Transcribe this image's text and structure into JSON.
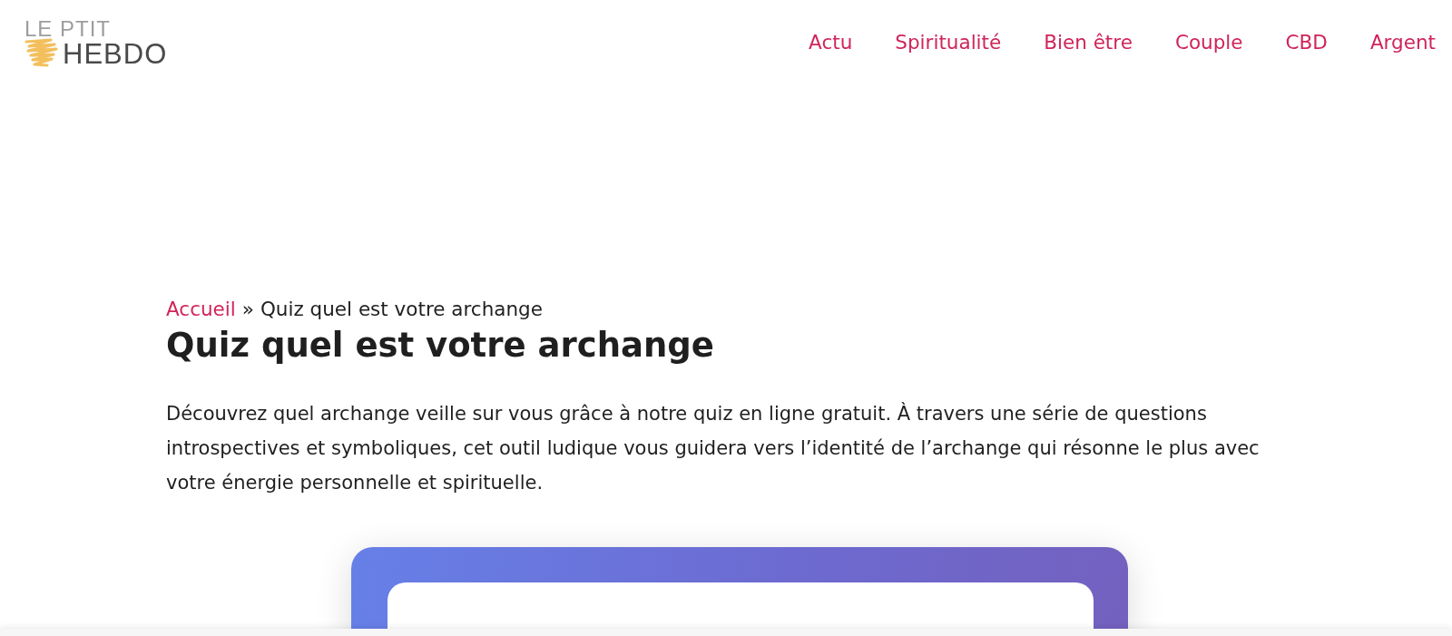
{
  "header": {
    "logo": {
      "line_1": "LE PTIT",
      "line_2": "HEBDO"
    },
    "nav": [
      {
        "label": "Actu"
      },
      {
        "label": "Spiritualité"
      },
      {
        "label": "Bien être"
      },
      {
        "label": "Couple"
      },
      {
        "label": "CBD"
      },
      {
        "label": "Argent"
      }
    ]
  },
  "breadcrumb": {
    "items": [
      {
        "label": "Accueil",
        "kind": "link"
      },
      {
        "label": "Quiz quel est votre archange",
        "kind": "current"
      }
    ],
    "separator": "»"
  },
  "title": "Quiz quel est votre archange",
  "intro": "Découvrez quel archange veille sur vous grâce à notre quiz en ligne gratuit. À travers une série de questions introspectives et symboliques, cet outil ludique vous guidera vers l’identité de l’archange qui résonne le plus avec votre énergie personnelle et spirituelle."
}
